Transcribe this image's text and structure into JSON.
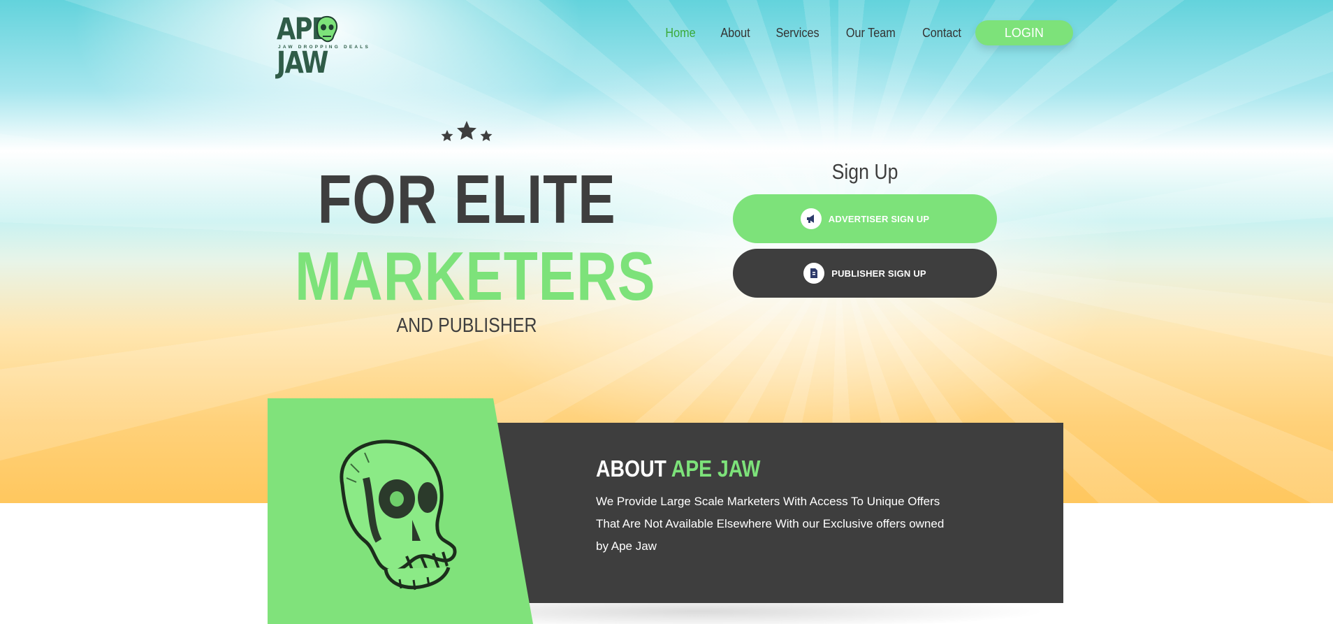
{
  "brand": {
    "logo_text_left": "APE",
    "logo_text_right": "JAW",
    "tagline": "JAW DROPPING DEALS"
  },
  "nav": {
    "items": [
      {
        "label": "Home",
        "active": true
      },
      {
        "label": "About",
        "active": false
      },
      {
        "label": "Services",
        "active": false
      },
      {
        "label": "Our Team",
        "active": false
      },
      {
        "label": "Contact",
        "active": false
      }
    ],
    "login_label": "LOGIN"
  },
  "hero": {
    "title_line1": "FOR ELITE",
    "title_line2": "MARKETERS",
    "subtitle": "AND PUBLISHER"
  },
  "signup": {
    "title": "Sign Up",
    "advertiser_label": "ADVERTISER SIGN UP",
    "advertiser_icon": "megaphone-icon",
    "publisher_label": "PUBLISHER SIGN UP",
    "publisher_icon": "document-icon"
  },
  "about": {
    "heading_prefix": "ABOUT ",
    "heading_accent": "APE JAW",
    "text": "We Provide Large Scale Marketers With Access To Unique Offers That Are Not Available Elsewhere With our Exclusive offers owned by Ape Jaw"
  },
  "colors": {
    "accent_green": "#7de27a",
    "dark": "#3e3e3e",
    "nav_active": "#3aaa3a"
  }
}
